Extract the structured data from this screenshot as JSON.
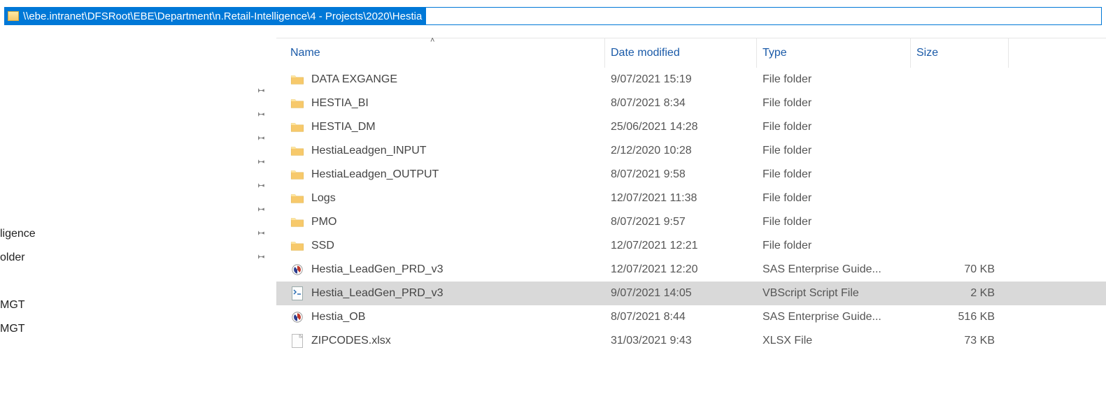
{
  "address_bar": {
    "path": "\\\\ebe.intranet\\DFSRoot\\EBE\\Department\\n.Retail-Intelligence\\4 - Projects\\2020\\Hestia"
  },
  "sidebar": {
    "items": [
      {
        "label": "",
        "pinned": true
      },
      {
        "label": "",
        "pinned": true
      },
      {
        "label": "",
        "pinned": true
      },
      {
        "label": "",
        "pinned": true
      },
      {
        "label": "",
        "pinned": true
      },
      {
        "label": "",
        "pinned": true
      },
      {
        "label": "ligence",
        "pinned": true
      },
      {
        "label": "older",
        "pinned": true
      },
      {
        "label": "",
        "pinned": false
      },
      {
        "label": "MGT",
        "pinned": false
      },
      {
        "label": "MGT",
        "pinned": false
      }
    ]
  },
  "columns": {
    "name": "Name",
    "date": "Date modified",
    "type": "Type",
    "size": "Size"
  },
  "files": [
    {
      "icon": "folder",
      "name": "DATA EXGANGE",
      "date": "9/07/2021 15:19",
      "type": "File folder",
      "size": "",
      "selected": false
    },
    {
      "icon": "folder",
      "name": "HESTIA_BI",
      "date": "8/07/2021 8:34",
      "type": "File folder",
      "size": "",
      "selected": false
    },
    {
      "icon": "folder",
      "name": "HESTIA_DM",
      "date": "25/06/2021 14:28",
      "type": "File folder",
      "size": "",
      "selected": false
    },
    {
      "icon": "folder",
      "name": "HestiaLeadgen_INPUT",
      "date": "2/12/2020 10:28",
      "type": "File folder",
      "size": "",
      "selected": false
    },
    {
      "icon": "folder",
      "name": "HestiaLeadgen_OUTPUT",
      "date": "8/07/2021 9:58",
      "type": "File folder",
      "size": "",
      "selected": false
    },
    {
      "icon": "folder",
      "name": "Logs",
      "date": "12/07/2021 11:38",
      "type": "File folder",
      "size": "",
      "selected": false
    },
    {
      "icon": "folder",
      "name": "PMO",
      "date": "8/07/2021 9:57",
      "type": "File folder",
      "size": "",
      "selected": false
    },
    {
      "icon": "folder",
      "name": "SSD",
      "date": "12/07/2021 12:21",
      "type": "File folder",
      "size": "",
      "selected": false
    },
    {
      "icon": "sas",
      "name": "Hestia_LeadGen_PRD_v3",
      "date": "12/07/2021 12:20",
      "type": "SAS Enterprise Guide...",
      "size": "70 KB",
      "selected": false
    },
    {
      "icon": "vbs",
      "name": "Hestia_LeadGen_PRD_v3",
      "date": "9/07/2021 14:05",
      "type": "VBScript Script File",
      "size": "2 KB",
      "selected": true
    },
    {
      "icon": "sas",
      "name": "Hestia_OB",
      "date": "8/07/2021 8:44",
      "type": "SAS Enterprise Guide...",
      "size": "516 KB",
      "selected": false
    },
    {
      "icon": "xlsx",
      "name": "ZIPCODES.xlsx",
      "date": "31/03/2021 9:43",
      "type": "XLSX File",
      "size": "73 KB",
      "selected": false
    }
  ],
  "icons": {
    "pin": "📌"
  }
}
